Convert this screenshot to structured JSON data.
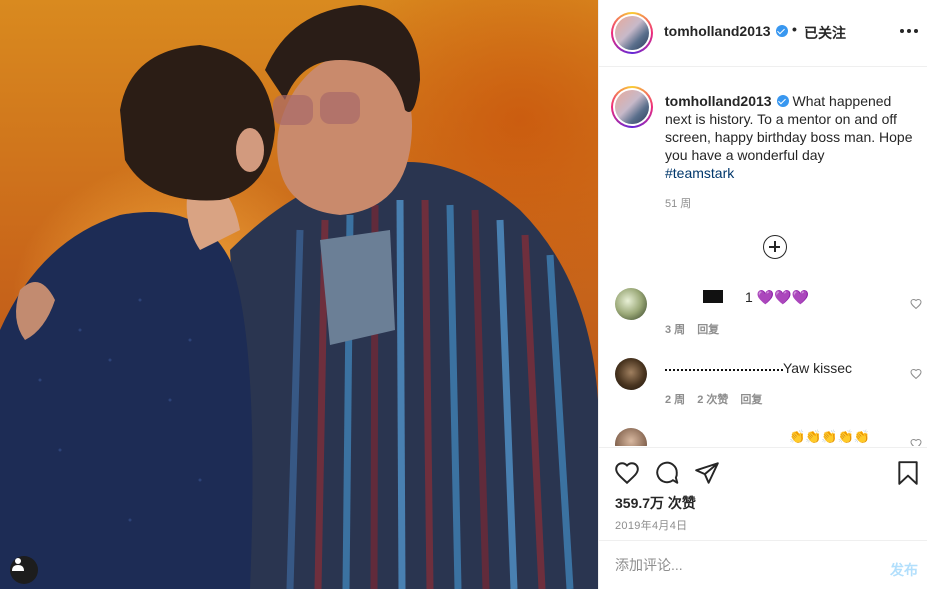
{
  "post": {
    "username": "tomholland2013",
    "separator": "•",
    "follow_status": "已关注",
    "more_icon": "more-horizontal-icon"
  },
  "caption": {
    "username": "tomholland2013",
    "text": "What happened next is history. To a mentor on and off screen, happy birthday boss man. Hope you have a wonderful day",
    "hashtag": "#teamstark",
    "time": "51 周"
  },
  "load_more_icon": "plus-circle-icon",
  "comments": [
    {
      "username_redacted": true,
      "text": "1 💜💜💜",
      "time": "3 周",
      "likes": "",
      "reply": "回复"
    },
    {
      "username_redacted": true,
      "text": "Yaw kissec",
      "time": "2 周",
      "likes": "2 次赞",
      "reply": "回复"
    },
    {
      "username_redacted": true,
      "text": "👏👏👏👏👏",
      "time": "",
      "likes": "",
      "reply": ""
    }
  ],
  "actions": {
    "like_icon": "heart-icon",
    "comment_icon": "comment-bubble-icon",
    "share_icon": "paper-plane-icon",
    "save_icon": "bookmark-icon"
  },
  "likes_count": "359.7万 次赞",
  "date": "2019年4月4日",
  "add_comment": {
    "placeholder": "添加评论...",
    "post_label": "发布"
  },
  "photo": {
    "user_tag_icon": "user-tag-icon"
  },
  "colors": {
    "accent": "#3897f0",
    "link": "#00376b",
    "muted": "#8e8e8e",
    "post_disabled": "#b2dffc"
  }
}
